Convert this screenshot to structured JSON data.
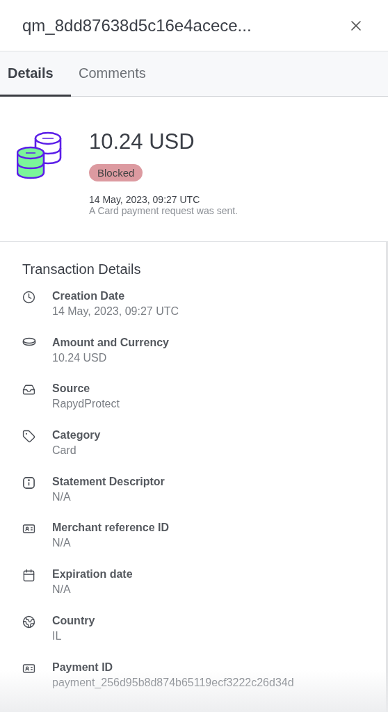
{
  "header": {
    "title": "qm_8dd87638d5c16e4acece..."
  },
  "tabs": [
    {
      "label": "Details",
      "selected": true
    },
    {
      "label": "Comments",
      "selected": false
    }
  ],
  "summary": {
    "amount": "10.24 USD",
    "status": {
      "label": "Blocked",
      "color": "#dc9aa0"
    },
    "date": "14 May, 2023, 09:27 UTC",
    "description": "A Card payment request was sent."
  },
  "section": {
    "title": "Transaction Details",
    "rows": [
      {
        "kind": "clock",
        "label": "Creation Date",
        "value": "14 May, 2023, 09:27 UTC"
      },
      {
        "kind": "coin",
        "label": "Amount and Currency",
        "value": "10.24 USD"
      },
      {
        "kind": "inbox",
        "label": "Source",
        "value": "RapydProtect"
      },
      {
        "kind": "tag",
        "label": "Category",
        "value": "Card"
      },
      {
        "kind": "info",
        "label": "Statement Descriptor",
        "value": "N/A"
      },
      {
        "kind": "idcard",
        "label": "Merchant reference ID",
        "value": "N/A"
      },
      {
        "kind": "calendar",
        "label": "Expiration date",
        "value": "N/A"
      },
      {
        "kind": "globe",
        "label": "Country",
        "value": "IL"
      },
      {
        "kind": "idcard",
        "label": "Payment ID",
        "value": "payment_256d95b8d874b65119ecf3222c26d34d"
      }
    ]
  }
}
